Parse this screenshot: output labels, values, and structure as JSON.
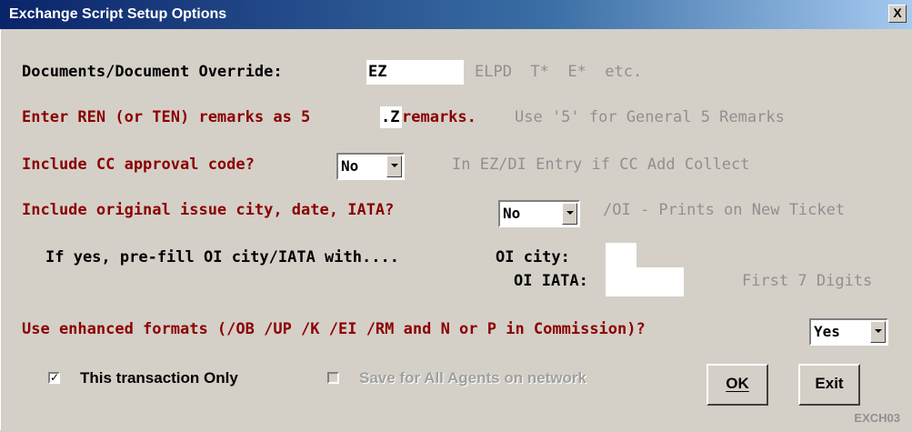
{
  "window": {
    "title": "Exchange Script Setup Options",
    "close_label": "X"
  },
  "documents": {
    "label": "Documents/Document Override:",
    "value": "EZ",
    "hint": "ELPD  T*  E*  etc."
  },
  "ren": {
    "label_pre": "Enter REN (or TEN) remarks as 5",
    "value": ".Z",
    "label_post": "remarks.",
    "hint": "Use '5' for General 5 Remarks"
  },
  "cc_approval": {
    "label": "Include CC approval code?",
    "selected": "No",
    "hint": "In EZ/DI Entry if CC Add Collect"
  },
  "original_issue": {
    "label": "Include original issue city, date, IATA?",
    "selected": "No",
    "hint": "/OI - Prints on New Ticket"
  },
  "prefill": {
    "label": "If yes, pre-fill OI city/IATA with....",
    "city_label": "OI city:",
    "city_value": "",
    "iata_label": "OI IATA:",
    "iata_value": "",
    "iata_hint": "First 7 Digits"
  },
  "enhanced": {
    "label": "Use enhanced formats (/OB /UP /K /EI /RM and N or P in Commission)?",
    "selected": "Yes"
  },
  "options": {
    "this_transaction": "This transaction Only",
    "this_transaction_checked": true,
    "all_agents": "Save for All Agents on network",
    "all_agents_checked": false
  },
  "buttons": {
    "ok": "OK",
    "exit": "Exit"
  },
  "form_code": "EXCH03"
}
